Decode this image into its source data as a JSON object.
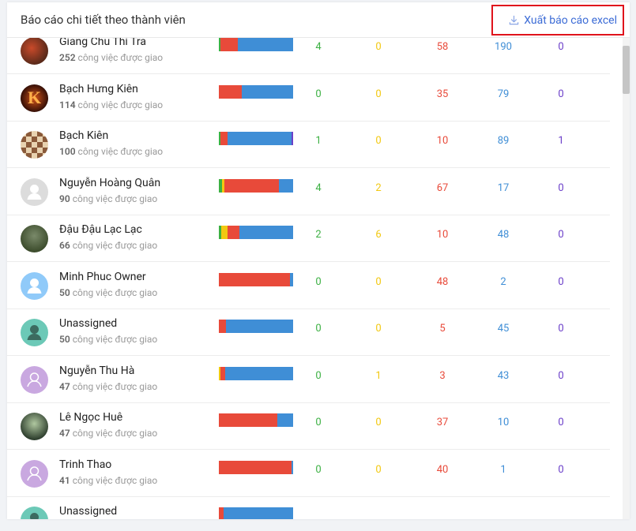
{
  "header": {
    "title": "Báo cáo chi tiết theo thành viên",
    "export_label": "Xuất báo cáo excel"
  },
  "colors": {
    "completed": "#3cb043",
    "pending": "#f2c811",
    "overdue": "#e84a3a",
    "in_progress": "#3f8ed6",
    "other": "#6b3fc9"
  },
  "members": [
    {
      "name": "Giang Chu Thi Tra",
      "count": "252",
      "suffix": "công việc được giao",
      "avatar": "photo-icon",
      "stats": [
        "4",
        "0",
        "58",
        "190",
        "0"
      ]
    },
    {
      "name": "Bạch Hưng Kiên",
      "count": "114",
      "suffix": "công việc được giao",
      "avatar": "photo-icon",
      "stats": [
        "0",
        "0",
        "35",
        "79",
        "0"
      ]
    },
    {
      "name": "Bạch Kiên",
      "count": "100",
      "suffix": "công việc được giao",
      "avatar": "chess-photo-icon",
      "stats": [
        "1",
        "0",
        "10",
        "89",
        "1"
      ]
    },
    {
      "name": "Nguyễn Hoàng Quân",
      "count": "90",
      "suffix": "công việc được giao",
      "avatar": "default-user-icon",
      "stats": [
        "4",
        "2",
        "67",
        "17",
        "0"
      ]
    },
    {
      "name": "Đậu Đậu Lạc Lạc",
      "count": "66",
      "suffix": "công việc được giao",
      "avatar": "photo-icon",
      "stats": [
        "2",
        "6",
        "10",
        "48",
        "0"
      ]
    },
    {
      "name": "Minh Phuc Owner",
      "count": "50",
      "suffix": "công việc được giao",
      "avatar": "user-icon",
      "stats": [
        "0",
        "0",
        "48",
        "2",
        "0"
      ]
    },
    {
      "name": "Unassigned",
      "count": "50",
      "suffix": "công việc được giao",
      "avatar": "user-icon",
      "stats": [
        "0",
        "0",
        "5",
        "45",
        "0"
      ]
    },
    {
      "name": "Nguyễn Thu Hà",
      "count": "47",
      "suffix": "công việc được giao",
      "avatar": "user-outline-icon",
      "stats": [
        "0",
        "1",
        "3",
        "43",
        "0"
      ]
    },
    {
      "name": "Lê Ngọc Huê",
      "count": "47",
      "suffix": "công việc được giao",
      "avatar": "photo-icon",
      "stats": [
        "0",
        "0",
        "37",
        "10",
        "0"
      ]
    },
    {
      "name": "Trinh Thao",
      "count": "41",
      "suffix": "công việc được giao",
      "avatar": "user-outline-icon",
      "stats": [
        "0",
        "0",
        "40",
        "1",
        "0"
      ]
    },
    {
      "name": "Unassigned",
      "count": "",
      "suffix": "",
      "avatar": "user-icon",
      "stats": [
        "",
        "",
        "",
        "",
        ""
      ]
    }
  ]
}
